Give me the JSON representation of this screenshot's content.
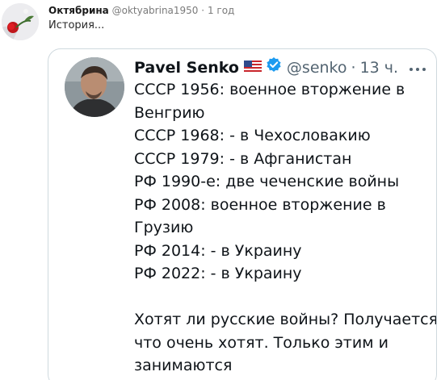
{
  "comment": {
    "author_name": "Октябрина",
    "handle": "@oktyabrina1950",
    "separator": "·",
    "time": "1 год",
    "text": "История..."
  },
  "embedded_tweet": {
    "author_name": "Pavel Senko",
    "flag_icon": "us-flag-icon",
    "verified_icon": "verified-badge-icon",
    "handle": "@senko",
    "separator": "·",
    "time": "13 ч.",
    "more_icon": "more-dots-icon",
    "lines": [
      "СССР 1956: военное вторжение в",
      "Венгрию",
      "СССР 1968: - в Чехословакию",
      "СССР 1979: - в Афганистан",
      "РФ 1990-е: две чеченские войны",
      "РФ 2008: военное вторжение в",
      "Грузию",
      "РФ 2014: - в Украину",
      "РФ 2022: - в Украину"
    ],
    "closing_lines": [
      "Хотят ли русские войны? Получается",
      "что очень хотят. Только этим и",
      "занимаются"
    ]
  },
  "colors": {
    "card_border": "#cfd9de",
    "verified_blue": "#1d9bf0",
    "muted_text": "#536471"
  }
}
